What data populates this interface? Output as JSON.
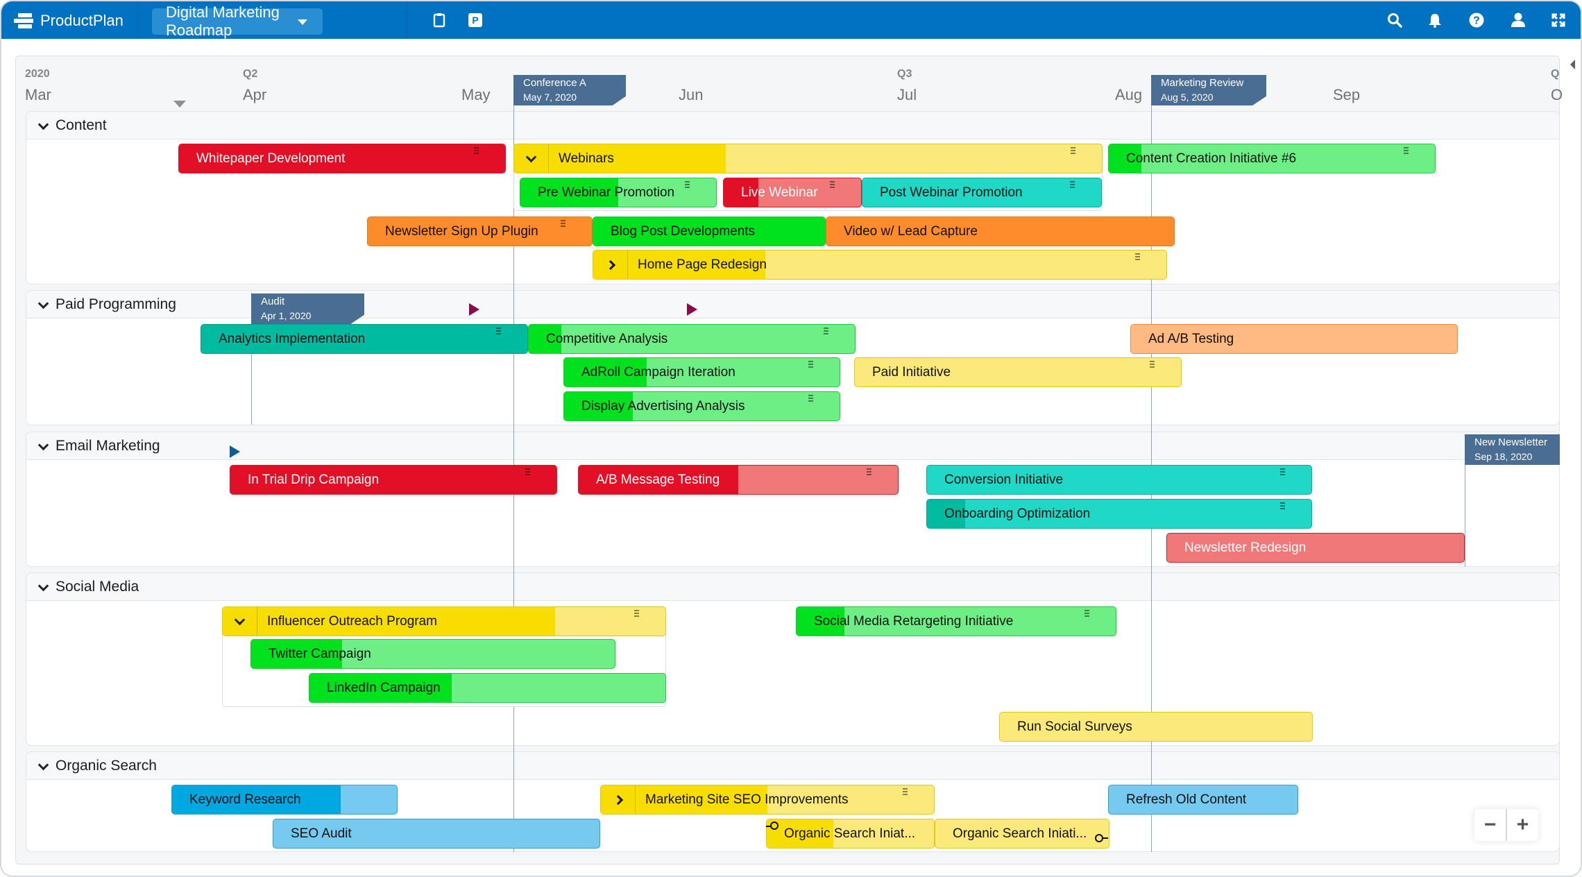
{
  "app": {
    "name": "ProductPlan",
    "roadmap_title": "Digital Marketing Roadmap",
    "toolbar_icons": [
      "clipboard-icon",
      "parking-icon"
    ],
    "right_icons": [
      "search-icon",
      "bell-icon",
      "help-icon",
      "user-icon",
      "fullscreen-icon"
    ]
  },
  "timeline": {
    "year": "2020",
    "quarters": [
      "Q2",
      "Q3",
      "Q"
    ],
    "months": [
      "Mar",
      "Apr",
      "May",
      "Jun",
      "Jul",
      "Aug",
      "Sep",
      "O"
    ]
  },
  "milestones": [
    {
      "name": "Conference A",
      "date": "May 7, 2020"
    },
    {
      "name": "Marketing Review",
      "date": "Aug 5, 2020"
    },
    {
      "name": "Audit",
      "date": "Apr 1, 2020"
    },
    {
      "name": "New Newsletter",
      "date": "Sep 18, 2020"
    }
  ],
  "lanes": [
    {
      "title": "Content",
      "bars": [
        {
          "label": "Whitepaper Development",
          "color": "red",
          "progress": 1.0
        },
        {
          "label": "Webinars",
          "color": "yellow",
          "progress": 0.36,
          "container": true
        },
        {
          "label": "Content Creation Initiative #6",
          "color": "green",
          "progress": 0.1
        },
        {
          "label": "Pre Webinar Promotion",
          "color": "green",
          "progress": 0.5
        },
        {
          "label": "Live Webinar",
          "color": "red",
          "progress": 0.25
        },
        {
          "label": "Post Webinar Promotion",
          "color": "teal",
          "progress": 0
        },
        {
          "label": "Newsletter Sign Up Plugin",
          "color": "orange",
          "progress": 1.0
        },
        {
          "label": "Blog Post Developments",
          "color": "green",
          "progress": 1.0
        },
        {
          "label": "Video w/ Lead Capture",
          "color": "orange",
          "progress": 1.0
        },
        {
          "label": "Home Page Redesign",
          "color": "yellow",
          "progress": 0.3,
          "container": true
        }
      ]
    },
    {
      "title": "Paid Programming",
      "bars": [
        {
          "label": "Analytics Implementation",
          "color": "teal-dark",
          "progress": 1.0
        },
        {
          "label": "Competitive Analysis",
          "color": "green",
          "progress": 0.1
        },
        {
          "label": "Ad A/B Testing",
          "color": "peach",
          "progress": 1.0
        },
        {
          "label": "AdRoll Campaign Iteration",
          "color": "green",
          "progress": 0.3
        },
        {
          "label": "Paid Initiative",
          "color": "yellow",
          "progress": 0
        },
        {
          "label": "Display Advertising Analysis",
          "color": "green",
          "progress": 0.25
        }
      ]
    },
    {
      "title": "Email Marketing",
      "bars": [
        {
          "label": "In Trial Drip Campaign",
          "color": "red",
          "progress": 1.0
        },
        {
          "label": "A/B Message Testing",
          "color": "red",
          "progress": 0.5
        },
        {
          "label": "Conversion Initiative",
          "color": "teal",
          "progress": 0
        },
        {
          "label": "Onboarding Optimization",
          "color": "teal",
          "progress": 0.1
        },
        {
          "label": "Newsletter Redesign",
          "color": "red",
          "progress": 0
        }
      ]
    },
    {
      "title": "Social Media",
      "bars": [
        {
          "label": "Influencer Outreach Program",
          "color": "yellow",
          "progress": 0.75,
          "container": true
        },
        {
          "label": "Social Media Retargeting Initiative",
          "color": "green",
          "progress": 0.15
        },
        {
          "label": "Twitter Campaign",
          "color": "green",
          "progress": 0.25
        },
        {
          "label": "LinkedIn Campaign",
          "color": "green",
          "progress": 0.4
        },
        {
          "label": "Run Social Surveys",
          "color": "yellow",
          "progress": 0
        }
      ]
    },
    {
      "title": "Organic Search",
      "bars": [
        {
          "label": "Keyword Research",
          "color": "blue",
          "progress": 0.75
        },
        {
          "label": "Marketing Site SEO Improvements",
          "color": "yellow",
          "progress": 0.5,
          "container": true
        },
        {
          "label": "Refresh Old Content",
          "color": "blue",
          "progress": 0
        },
        {
          "label": "SEO Audit",
          "color": "blue",
          "progress": 0
        },
        {
          "label": "Organic Search Iniat...",
          "color": "yellow",
          "progress": 0.4
        },
        {
          "label": "Organic Search Iniati...",
          "color": "yellow",
          "progress": 0
        }
      ]
    }
  ],
  "zoom": {
    "minus": "−",
    "plus": "+"
  }
}
